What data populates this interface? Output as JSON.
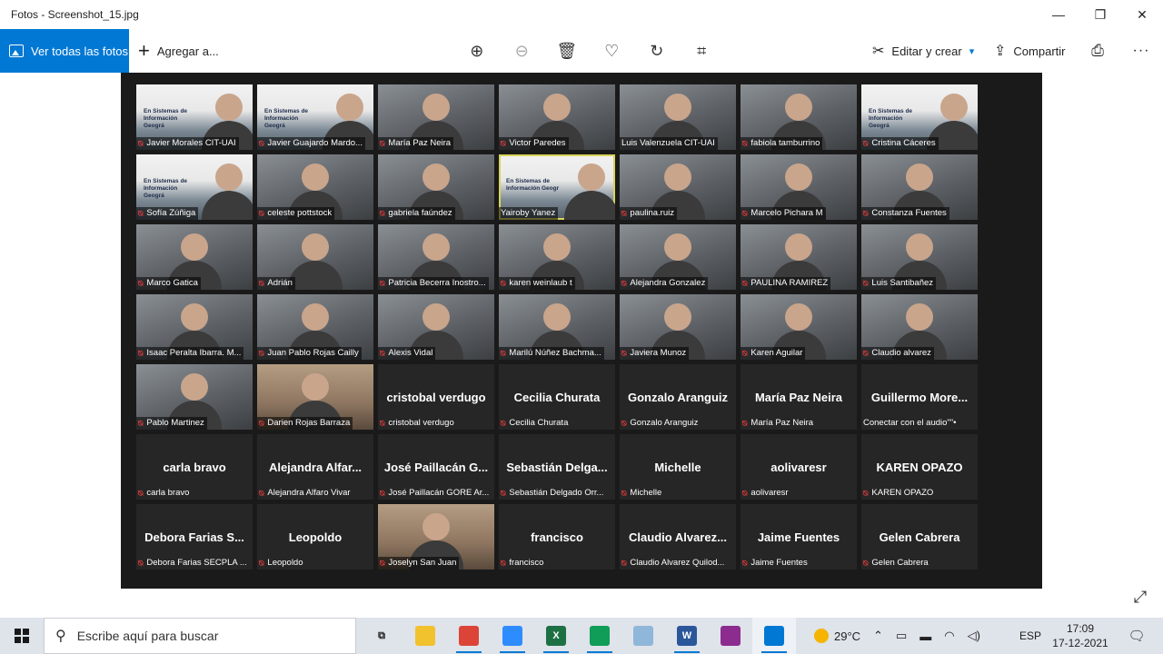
{
  "window": {
    "title": "Fotos - Screenshot_15.jpg",
    "controls": {
      "minimize": "—",
      "maximize": "❐",
      "close": "✕"
    }
  },
  "toolbar": {
    "view_all_label": "Ver todas las fotos",
    "add_label": "Agregar a...",
    "edit_label": "Editar y crear",
    "share_label": "Compartir",
    "icons": [
      "zoom-in-icon",
      "zoom-out-icon",
      "delete-icon",
      "favorite-icon",
      "rotate-icon",
      "crop-icon",
      "print-icon",
      "more-icon"
    ]
  },
  "meeting": {
    "tiles": [
      {
        "name": "Javier Morales CIT-UAI",
        "kind": "slide",
        "slide_text": "En Sistemas de Información Geográ"
      },
      {
        "name": "Javier Guajardo Mardo...",
        "kind": "slide",
        "slide_text": "En Sistemas de Información Geográ"
      },
      {
        "name": "María Paz Neira",
        "kind": "video"
      },
      {
        "name": "Victor Paredes",
        "kind": "video"
      },
      {
        "name": "Luis Valenzuela CIT-UAI",
        "kind": "video",
        "no_mic": true
      },
      {
        "name": "fabiola tamburrino",
        "kind": "video"
      },
      {
        "name": "Cristina Cáceres",
        "kind": "slide",
        "slide_text": "En Sistemas de Información Geográ"
      },
      {
        "name": "Sofía Zúñiga",
        "kind": "slide",
        "slide_text": "En Sistemas de Información Geográ"
      },
      {
        "name": "celeste pottstock",
        "kind": "video"
      },
      {
        "name": "gabriela faúndez",
        "kind": "video"
      },
      {
        "name": "Yairoby Yanez",
        "kind": "slide",
        "slide_text": "En Sistemas de Información Geogr",
        "active": true,
        "no_mic": true
      },
      {
        "name": "paulina.ruiz",
        "kind": "video"
      },
      {
        "name": "Marcelo Pichara M",
        "kind": "video"
      },
      {
        "name": "Constanza Fuentes",
        "kind": "video"
      },
      {
        "name": "Marco Gatica",
        "kind": "video"
      },
      {
        "name": "Adrián",
        "kind": "video"
      },
      {
        "name": "Patricia Becerra Inostro...",
        "kind": "video"
      },
      {
        "name": "karen weinlaub t",
        "kind": "video"
      },
      {
        "name": "Alejandra Gonzalez",
        "kind": "video"
      },
      {
        "name": "PAULINA RAMIREZ",
        "kind": "video"
      },
      {
        "name": "Luis Santibañez",
        "kind": "video"
      },
      {
        "name": "Isaac Peralta Ibarra. M...",
        "kind": "video"
      },
      {
        "name": "Juan Pablo Rojas Cailly",
        "kind": "video"
      },
      {
        "name": "Alexis Vidal",
        "kind": "video"
      },
      {
        "name": "Marilú Núñez Bachma...",
        "kind": "video"
      },
      {
        "name": "Javiera Munoz",
        "kind": "video"
      },
      {
        "name": "Karen Aguilar",
        "kind": "video"
      },
      {
        "name": "Claudio alvarez",
        "kind": "video"
      },
      {
        "name": "Pablo Martinez",
        "kind": "video"
      },
      {
        "name": "Darien Rojas Barraza",
        "kind": "photo"
      },
      {
        "name": "cristobal verdugo",
        "kind": "text",
        "display": "cristobal verdugo"
      },
      {
        "name": "Cecilia Churata",
        "kind": "text",
        "display": "Cecilia Churata"
      },
      {
        "name": "Gonzalo Aranguiz",
        "kind": "text",
        "display": "Gonzalo Aranguiz"
      },
      {
        "name": "María Paz Neira",
        "kind": "text",
        "display": "María Paz Neira"
      },
      {
        "name": "Conectar con el audio",
        "kind": "text",
        "display": "Guillermo More...",
        "no_mic": true,
        "suffix": " \"\"•"
      },
      {
        "name": "carla bravo",
        "kind": "text",
        "display": "carla bravo"
      },
      {
        "name": "Alejandra Alfaro Vivar",
        "kind": "text",
        "display": "Alejandra Alfar..."
      },
      {
        "name": "José Paillacán GORE Ar...",
        "kind": "text",
        "display": "José Paillacán G..."
      },
      {
        "name": "Sebastián Delgado Orr...",
        "kind": "text",
        "display": "Sebastián Delga..."
      },
      {
        "name": "Michelle",
        "kind": "text",
        "display": "Michelle"
      },
      {
        "name": "aolivaresr",
        "kind": "text",
        "display": "aolivaresr"
      },
      {
        "name": "KAREN OPAZO",
        "kind": "text",
        "display": "KAREN OPAZO"
      },
      {
        "name": "Debora Farias SECPLA ...",
        "kind": "text",
        "display": "Debora Farias S..."
      },
      {
        "name": "Leopoldo",
        "kind": "text",
        "display": "Leopoldo"
      },
      {
        "name": "Joselyn San Juan",
        "kind": "photo"
      },
      {
        "name": "francisco",
        "kind": "text",
        "display": "francisco"
      },
      {
        "name": "Claudio Alvarez Quilod...",
        "kind": "text",
        "display": "Claudio Alvarez..."
      },
      {
        "name": "Jaime Fuentes",
        "kind": "text",
        "display": "Jaime Fuentes"
      },
      {
        "name": "Gelen Cabrera",
        "kind": "text",
        "display": "Gelen Cabrera"
      }
    ]
  },
  "taskbar": {
    "search_placeholder": "Escribe aquí para buscar",
    "apps": [
      {
        "name": "task-view-icon",
        "glyph": "⧉",
        "color": "#dfe3ea",
        "fg": "#222"
      },
      {
        "name": "file-explorer-icon",
        "glyph": "",
        "color": "#f2c12e",
        "fg": "#fff"
      },
      {
        "name": "chrome-icon",
        "glyph": "",
        "color": "#db4437",
        "fg": "#fff",
        "open": true
      },
      {
        "name": "zoom-icon",
        "glyph": "",
        "color": "#2d8cff",
        "fg": "#fff",
        "open": true
      },
      {
        "name": "excel-icon",
        "glyph": "X",
        "color": "#1d7044",
        "fg": "#fff",
        "open": true
      },
      {
        "name": "chrome-profile-icon",
        "glyph": "",
        "color": "#0f9d58",
        "fg": "#fff",
        "open": true
      },
      {
        "name": "app-blue-icon",
        "glyph": "",
        "color": "#8fb7d9",
        "fg": "#fff"
      },
      {
        "name": "word-icon",
        "glyph": "W",
        "color": "#2b579a",
        "fg": "#fff",
        "open": true
      },
      {
        "name": "winrar-icon",
        "glyph": "",
        "color": "#8b2c8e",
        "fg": "#fff"
      },
      {
        "name": "photos-icon",
        "glyph": "",
        "color": "#0078d4",
        "fg": "#fff",
        "open": true,
        "active": true
      }
    ],
    "weather": "29°C",
    "language": "ESP",
    "time": "17:09",
    "date": "17-12-2021",
    "notification_count": "1"
  }
}
